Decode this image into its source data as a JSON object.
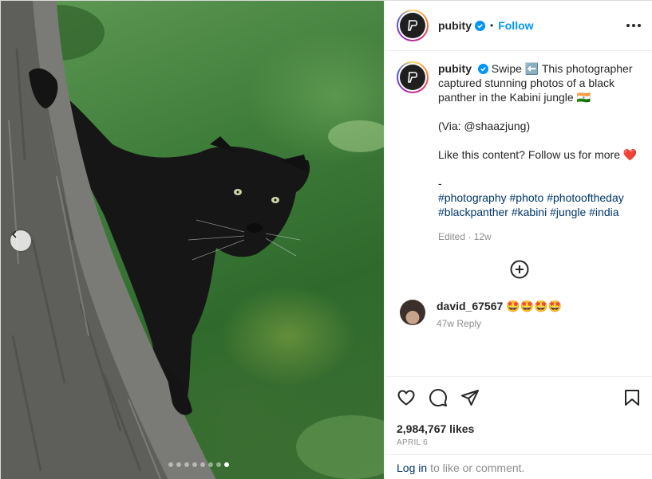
{
  "post": {
    "username": "pubity",
    "separator": "•",
    "follow_label": "Follow",
    "caption": {
      "line1": "Swipe ⬅️ This photographer captured stunning photos of a black panther in the Kabini jungle 🇮🇳",
      "via": "(Via: @shaazjung)",
      "cta": "Like this content? Follow us for more ❤️",
      "dash": "-",
      "hashtags": "#photography #photo #photooftheday #blackpanther #kabini #jungle #india"
    },
    "edited_meta": "Edited · 12w"
  },
  "comment": {
    "username": "david_67567",
    "text": "🤩🤩🤩🤩",
    "sub": "47w Reply"
  },
  "likes": "2,984,767 likes",
  "date": "APRIL 6",
  "login": {
    "link": "Log in",
    "rest": "to like or comment."
  },
  "carousel": {
    "total": 8,
    "active": 8
  },
  "icons": [
    "chevron-left-icon",
    "verified-icon",
    "more-icon",
    "add-circle-icon",
    "heart-icon",
    "comment-icon",
    "share-icon",
    "bookmark-icon"
  ],
  "colors": {
    "accent": "#0095f6",
    "hashtag": "#00376b",
    "muted": "#8e8e8e"
  }
}
